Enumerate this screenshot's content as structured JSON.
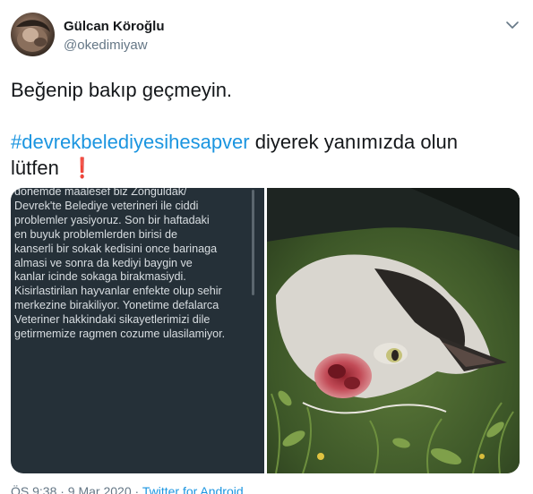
{
  "user": {
    "name": "Gülcan Köroğlu",
    "handle": "@okedimiyaw"
  },
  "tweet": {
    "line1": "Beğenip bakıp geçmeyin.",
    "hashtag": "#devrekbelediyesihesapver",
    "line2_rest": " diyerek yanımızda olun",
    "line3": "lütfen",
    "emoji": "❗"
  },
  "media": {
    "screenshot_text": "donemde maalesef biz Zonguldak/\nDevrek'te Belediye veterineri ile ciddi\nproblemler yasiyoruz. Son bir haftadaki\nen buyuk problemlerden birisi de\nkanserli bir sokak kedisini once barinaga\nalmasi ve sonra da kediyi baygin ve\nkanlar icinde sokaga birakmasiydi.\nKisirlastirilan hayvanlar enfekte olup sehir\nmerkezine birakiliyor. Yonetime defalarca\nVeteriner hakkindaki sikayetlerimizi dile\ngetirmemize ragmen cozume ulasilamiyor.",
    "photo_icon": "injured-cat-photo"
  },
  "footer": {
    "time": "ÖS 9:38 · 9 Mar 2020 · ",
    "source": "Twitter for Android"
  },
  "icons": {
    "caret": "chevron-down-icon"
  },
  "colors": {
    "link": "#1b95e0",
    "text": "#14171a",
    "secondary": "#657786",
    "emoji": "#d0021b"
  }
}
